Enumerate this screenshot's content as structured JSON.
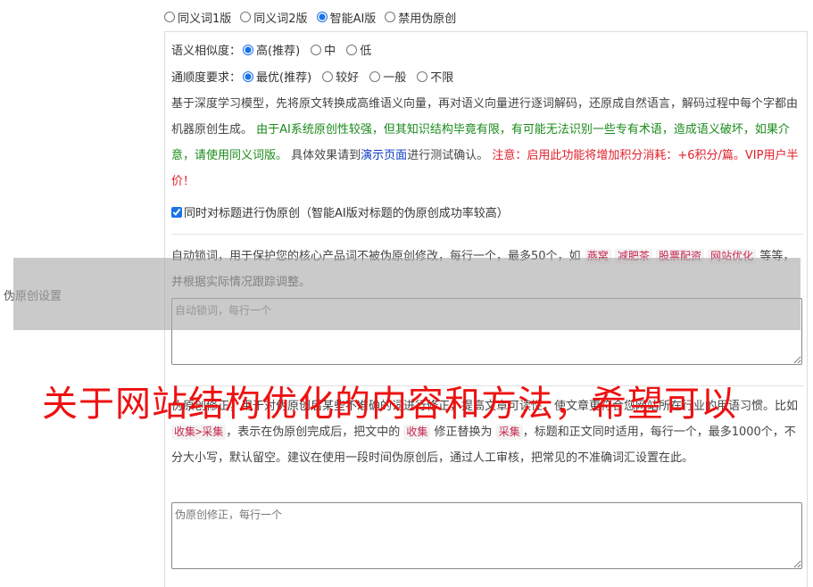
{
  "side_label": "伪原创设置",
  "modes": {
    "options": [
      "同义词1版",
      "同义词2版",
      "智能AI版",
      "禁用伪原创"
    ],
    "selected": "智能AI版"
  },
  "similarity": {
    "label": "语义相似度：",
    "options": [
      "高(推荐)",
      "中",
      "低"
    ],
    "selected": "高(推荐)"
  },
  "fluency": {
    "label": "通顺度要求：",
    "options": [
      "最优(推荐)",
      "较好",
      "一般",
      "不限"
    ],
    "selected": "最优(推荐)"
  },
  "ai_description": {
    "intro": "基于深度学习模型，先将原文转换成高维语义向量，再对语义向量进行逐词解码，还原成自然语言，解码过程中每个字都由机器原创生成。",
    "warning_green": "由于AI系统原创性较强，但其知识结构毕竟有限，有可能无法识别一些专有术语，造成语义破坏，如果介意，请使用同义词版。",
    "effect_prefix": "具体效果请到",
    "demo_link": "演示页面",
    "effect_suffix": "进行测试确认。",
    "notice_red": "注意：启用此功能将增加积分消耗：+6积分/篇。VIP用户半价！"
  },
  "title_checkbox": {
    "checked": true,
    "label": "同时对标题进行伪原创（智能AI版对标题的伪原创成功率较高）"
  },
  "lock_words": {
    "desc_prefix": "自动锁词，用于保护您的核心产品词不被伪原创修改，每行一个，最多50个，如",
    "examples": [
      "燕窝",
      "减肥茶",
      "股票配资",
      "网站优化"
    ],
    "desc_suffix": "等等，并根据实际情况跟踪调整。",
    "placeholder": "自动锁词，每行一个"
  },
  "correction": {
    "desc_a": "伪原创修正，用于对伪原创后某些不准确的词进行修正，提高文章可读性，使文章更符合您网站所在行业的用语习惯。比如",
    "example_rule": "收集>采集",
    "desc_b": "，表示在伪原创完成后，把文中的",
    "word_from": "收集",
    "desc_c": "修正替换为",
    "word_to": "采集",
    "desc_d": "，标题和正文同时适用，每行一个，最多1000个，不分大小写，默认留空。建议在使用一段时间伪原创后，通过人工审核，把常见的不准确词汇设置在此。",
    "placeholder": "伪原创修正，每行一个"
  },
  "overlay_text": "关于网站结构优化的内容和方法，希望可以"
}
